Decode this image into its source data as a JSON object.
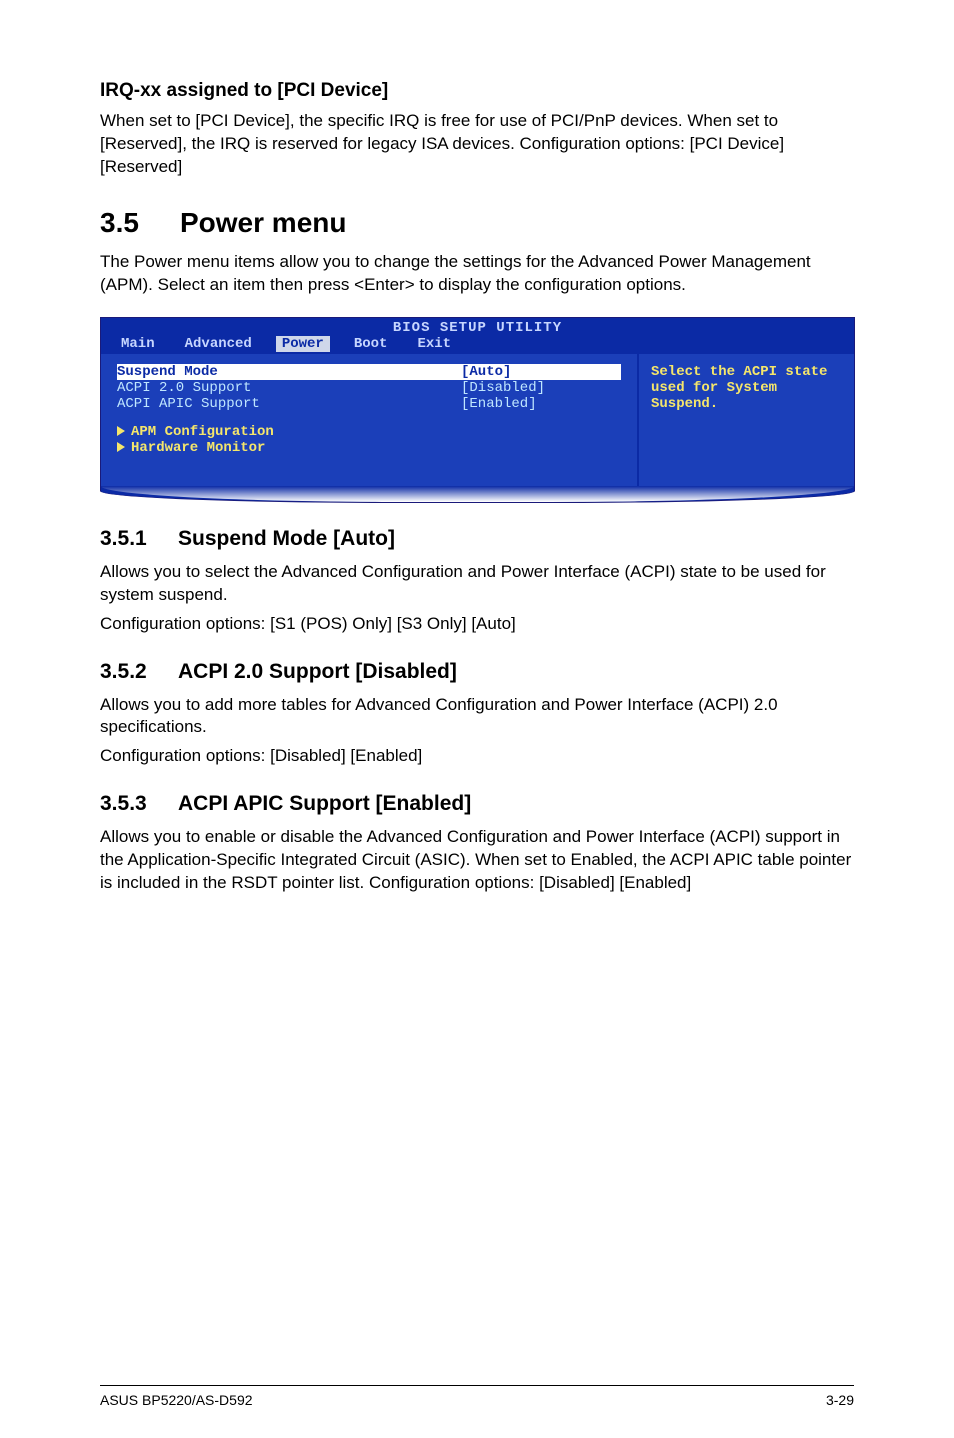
{
  "section_irq": {
    "title": "IRQ-xx assigned to [PCI Device]",
    "p1": "When set to [PCI Device], the specific IRQ is free for use of PCI/PnP devices. When set to [Reserved], the IRQ is reserved for legacy ISA devices. Configuration options: [PCI Device] [Reserved]"
  },
  "heading35": {
    "num": "3.5",
    "title": "Power menu"
  },
  "para35": "The Power menu items allow you to change the settings for the Advanced Power Management (APM). Select an item then press <Enter> to display the configuration options.",
  "bios": {
    "title": "BIOS SETUP UTILITY",
    "tabs": [
      "Main",
      "Advanced",
      "Power",
      "Boot",
      "Exit"
    ],
    "active_tab_index": 2,
    "rows": [
      {
        "label": "Suspend Mode",
        "value": "[Auto]",
        "selected": true
      },
      {
        "label": "ACPI 2.0 Support",
        "value": "[Disabled]",
        "selected": false
      },
      {
        "label": "ACPI APIC Support",
        "value": "[Enabled]",
        "selected": false
      }
    ],
    "subs": [
      "APM Configuration",
      "Hardware Monitor"
    ],
    "help": "Select the ACPI state used for System Suspend."
  },
  "s351": {
    "num": "3.5.1",
    "title": "Suspend Mode [Auto]",
    "p1": "Allows you to select the Advanced Configuration and Power Interface (ACPI) state to be used for system suspend.",
    "p2": "Configuration options: [S1 (POS) Only] [S3 Only] [Auto]"
  },
  "s352": {
    "num": "3.5.2",
    "title": "ACPI 2.0 Support [Disabled]",
    "p1": "Allows you to add more tables for Advanced Configuration and Power Interface (ACPI) 2.0 specifications.",
    "p2": "Configuration options: [Disabled] [Enabled]"
  },
  "s353": {
    "num": "3.5.3",
    "title": "ACPI APIC Support [Enabled]",
    "p1": "Allows you to enable or disable the Advanced Configuration and Power Interface (ACPI) support in the Application-Specific Integrated Circuit (ASIC). When set to Enabled, the ACPI APIC table pointer is included in the RSDT pointer list. Configuration options: [Disabled] [Enabled]"
  },
  "footer": {
    "left": "ASUS BP5220/AS-D592",
    "right": "3-29"
  }
}
